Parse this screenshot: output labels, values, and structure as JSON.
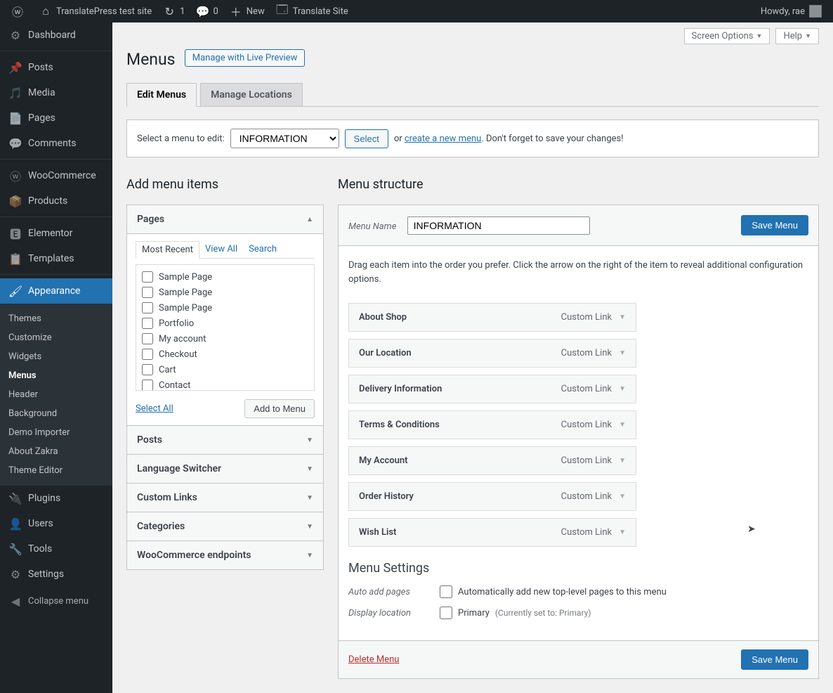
{
  "adminbar": {
    "siteName": "TranslatePress test site",
    "updates": "1",
    "comments": "0",
    "newLabel": "New",
    "translate": "Translate Site",
    "greeting": "Howdy, rae"
  },
  "sidebar": {
    "items": [
      {
        "label": "Dashboard",
        "icon": "⚙"
      },
      {
        "label": "Posts",
        "icon": "📌"
      },
      {
        "label": "Media",
        "icon": "🎵"
      },
      {
        "label": "Pages",
        "icon": "📄"
      },
      {
        "label": "Comments",
        "icon": "💬"
      },
      {
        "label": "WooCommerce",
        "icon": "ⓦ"
      },
      {
        "label": "Products",
        "icon": "📦"
      },
      {
        "label": "Elementor",
        "icon": "🅴"
      },
      {
        "label": "Templates",
        "icon": "📋"
      },
      {
        "label": "Appearance",
        "icon": "🖌"
      },
      {
        "label": "Plugins",
        "icon": "🔌"
      },
      {
        "label": "Users",
        "icon": "👤"
      },
      {
        "label": "Tools",
        "icon": "🔧"
      },
      {
        "label": "Settings",
        "icon": "⚙"
      }
    ],
    "subAppearance": [
      "Themes",
      "Customize",
      "Widgets",
      "Menus",
      "Header",
      "Background",
      "Demo Importer",
      "About Zakra",
      "Theme Editor"
    ],
    "collapse": "Collapse menu"
  },
  "topCtrl": {
    "screen": "Screen Options",
    "help": "Help"
  },
  "header": {
    "title": "Menus",
    "livePreview": "Manage with Live Preview"
  },
  "tabs": {
    "edit": "Edit Menus",
    "locations": "Manage Locations"
  },
  "selectbar": {
    "label": "Select a menu to edit:",
    "options": [
      "INFORMATION"
    ],
    "selected": "INFORMATION",
    "selectBtn": "Select",
    "or": "or",
    "createNew": "create a new menu",
    "tail": ". Don't forget to save your changes!"
  },
  "addItemsHeading": "Add menu items",
  "structureHeading": "Menu structure",
  "accordion": {
    "pages": {
      "title": "Pages",
      "subtabs": [
        "Most Recent",
        "View All",
        "Search"
      ],
      "items": [
        "Sample Page",
        "Sample Page",
        "Sample Page",
        "Portfolio",
        "My account",
        "Checkout",
        "Cart",
        "Contact"
      ],
      "selectAll": "Select All",
      "addToMenu": "Add to Menu"
    },
    "closed": [
      "Posts",
      "Language Switcher",
      "Custom Links",
      "Categories",
      "WooCommerce endpoints"
    ]
  },
  "struct": {
    "menuNameLabel": "Menu Name",
    "menuName": "INFORMATION",
    "save": "Save Menu",
    "desc": "Drag each item into the order you prefer. Click the arrow on the right of the item to reveal additional configuration options.",
    "items": [
      {
        "label": "About Shop",
        "type": "Custom Link"
      },
      {
        "label": "Our Location",
        "type": "Custom Link"
      },
      {
        "label": "Delivery Information",
        "type": "Custom Link"
      },
      {
        "label": "Terms & Conditions",
        "type": "Custom Link"
      },
      {
        "label": "My Account",
        "type": "Custom Link"
      },
      {
        "label": "Order History",
        "type": "Custom Link"
      },
      {
        "label": "Wish List",
        "type": "Custom Link"
      }
    ],
    "settingsTitle": "Menu Settings",
    "autoAddLabel": "Auto add pages",
    "autoAddCheck": "Automatically add new top-level pages to this menu",
    "displayLocLabel": "Display location",
    "primary": "Primary",
    "primaryHint": "(Currently set to: Primary)",
    "delete": "Delete Menu"
  }
}
